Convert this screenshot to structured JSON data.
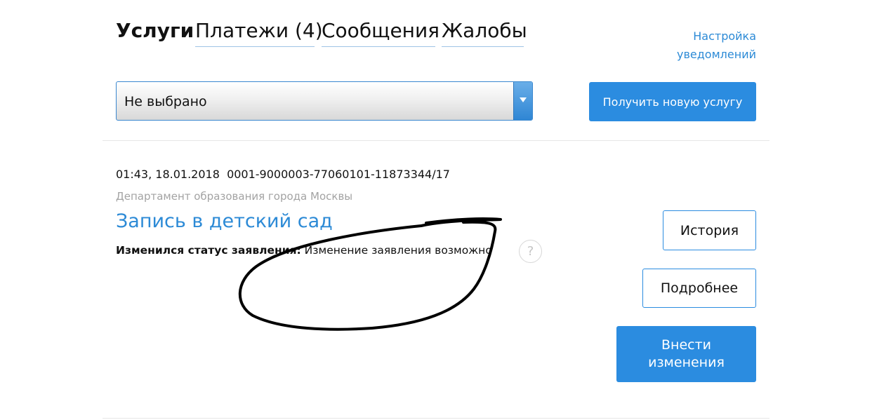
{
  "tabs": {
    "services": "Услуги",
    "payments": "Платежи (4)",
    "messages": "Сообщения",
    "complaints": "Жалобы"
  },
  "notification_settings": {
    "line1": "Настройка",
    "line2": "уведомлений"
  },
  "filter": {
    "selected": "Не выбрано"
  },
  "get_new_service_button": "Получить новую услугу",
  "application": {
    "datetime_and_number": "01:43, 18.01.2018  0001-9000003-77060101-11873344/17",
    "department": "Департамент образования города Москвы",
    "title": "Запись в детский сад",
    "status_label": "Изменился статус заявления:",
    "status_value": " Изменение заявления возможно",
    "help_symbol": "?"
  },
  "buttons": {
    "history": "История",
    "details": "Подробнее",
    "make_changes_line1": "Внести",
    "make_changes_line2": "изменения"
  },
  "colors": {
    "accent": "#2b8ce0",
    "link": "#2c8ad6",
    "muted_text": "#a3a3a3"
  }
}
